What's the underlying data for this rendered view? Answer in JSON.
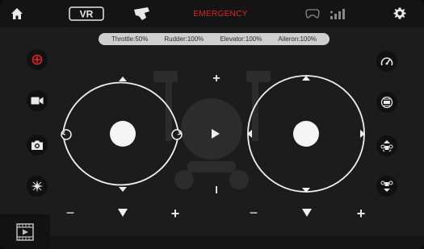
{
  "topbar": {
    "emergency_label": "EMERGENCY",
    "vr_label": "VR"
  },
  "status": {
    "throttle": "Throttle:50%",
    "rudder": "Rudder:100%",
    "elevator": "Elevator:100%",
    "aileron": "Aileron:100%"
  },
  "controls": {
    "plus": "+",
    "minus": "−",
    "trim_mid": "I"
  },
  "colors": {
    "accent_red": "#e0252b",
    "icon": "#e8e8e8",
    "background": "#1c1c1c"
  }
}
